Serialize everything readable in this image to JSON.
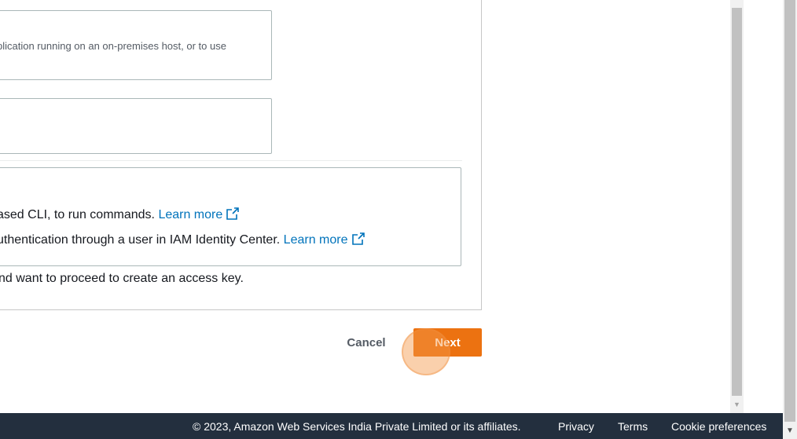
{
  "options": {
    "option1_description": "plication running on an on-premises host, or to use"
  },
  "alternatives": {
    "line1_text": "ased CLI, to run commands.",
    "line1_link": "Learn more",
    "line2_text": "uthentication through a user in IAM Identity Center.",
    "line2_link": "Learn more",
    "link_icon": "external-link-icon"
  },
  "confirmation": {
    "text": "nd want to proceed to create an access key."
  },
  "actions": {
    "cancel_label": "Cancel",
    "next_label": "Next"
  },
  "footer": {
    "copyright": "© 2023, Amazon Web Services India Private Limited or its affiliates.",
    "privacy": "Privacy",
    "terms": "Terms",
    "cookie_preferences": "Cookie preferences"
  },
  "colors": {
    "primary_button": "#ec7211",
    "link": "#0073bb",
    "footer_bg": "#232f3e"
  }
}
